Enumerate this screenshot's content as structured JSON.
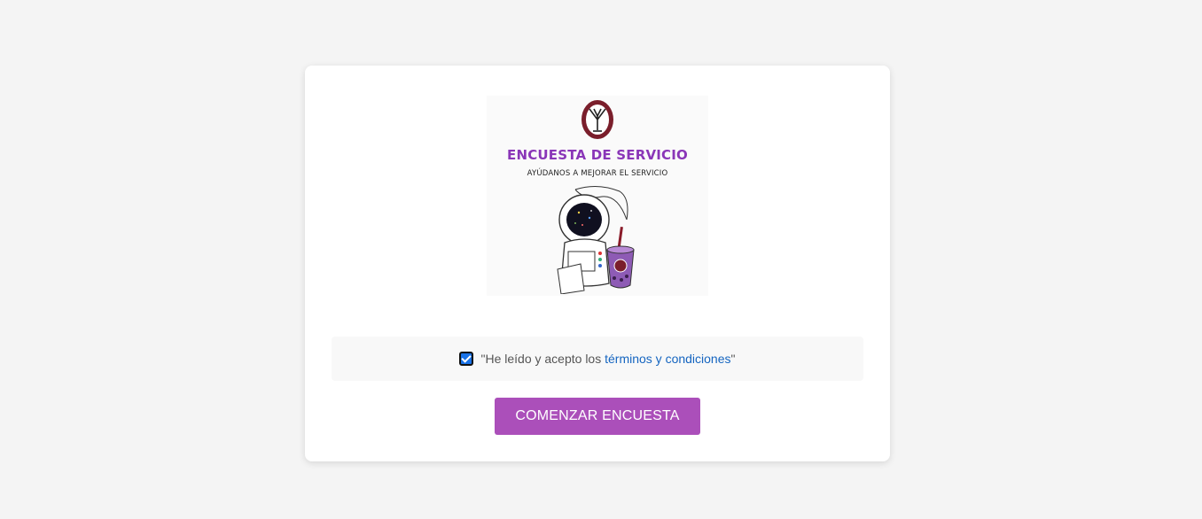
{
  "banner": {
    "title": "ENCUESTA DE SERVICIO",
    "subtitle": "AYÚDANOS A MEJORAR EL SERVICIO",
    "logo_icon": "tree-crest-logo",
    "illustration": "astronaut-with-boba-drink",
    "colors": {
      "title": "#8a36b8",
      "crest": "#7a1e2b",
      "drink": "#8e5bb5"
    }
  },
  "terms": {
    "checked": true,
    "open_quote": "\"",
    "text_before": "He leído y acepto los ",
    "link_text": "términos y condiciones",
    "close_quote": "\""
  },
  "actions": {
    "start_label": "COMENZAR ENCUESTA",
    "start_color": "#ab4fba"
  }
}
